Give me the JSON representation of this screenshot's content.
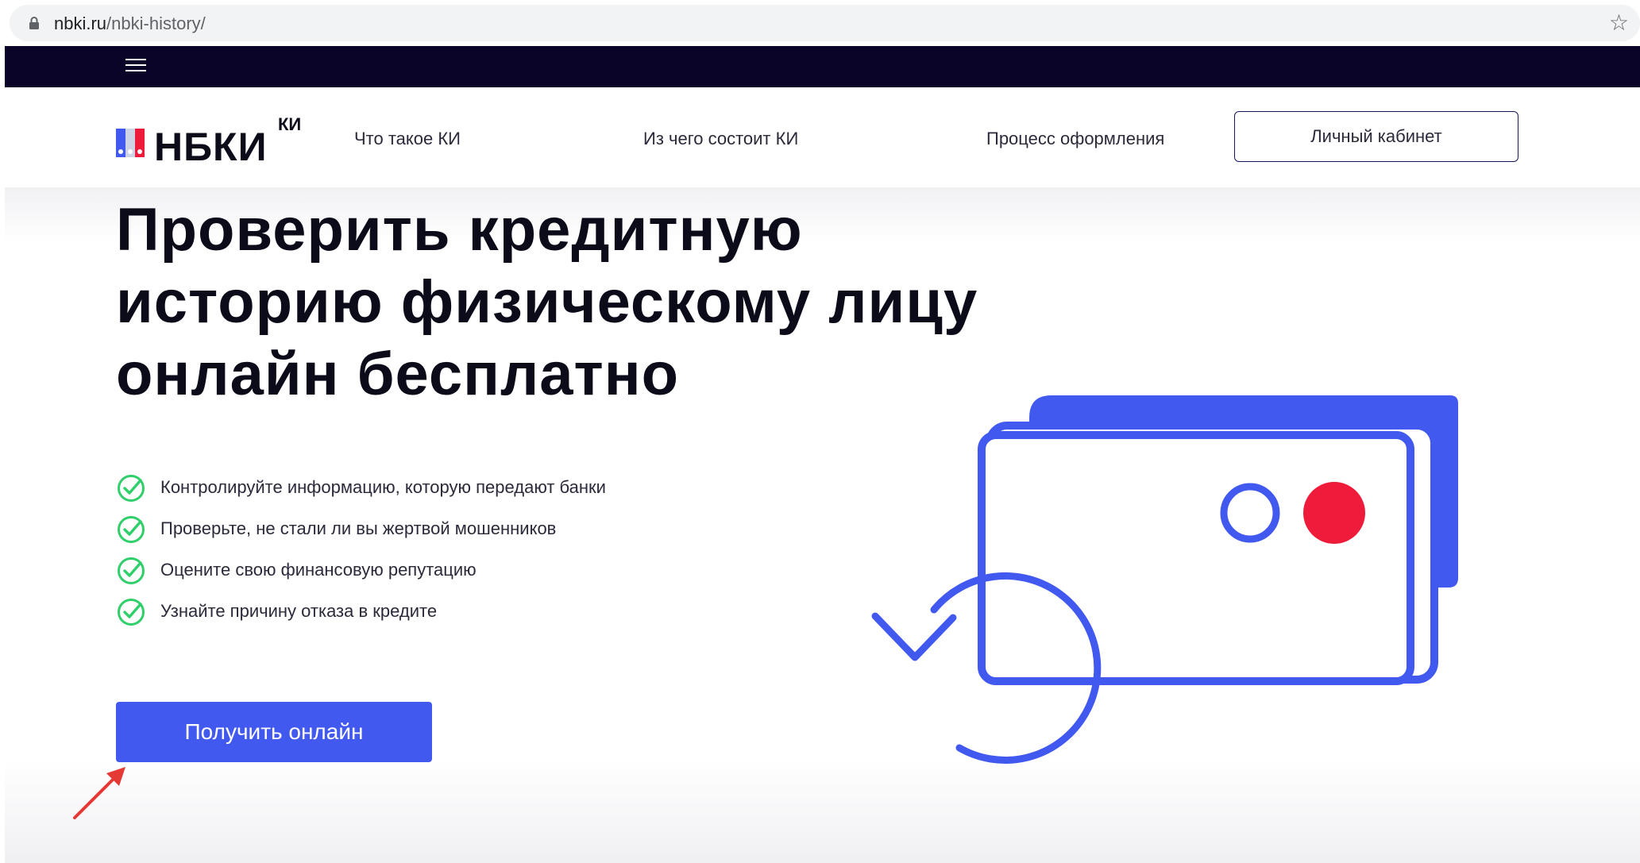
{
  "browser": {
    "url_host": "nbki.ru",
    "url_path": "/nbki-history/"
  },
  "header": {
    "logo_text": "НБКИ",
    "logo_sup": "КИ",
    "nav": [
      {
        "label": "Что такое КИ"
      },
      {
        "label": "Из чего состоит КИ"
      },
      {
        "label": "Процесс оформления"
      }
    ],
    "cabinet_label": "Личный кабинет"
  },
  "hero": {
    "title_lines": [
      "Проверить кредитную",
      "историю физическому лицу",
      "онлайн бесплатно"
    ],
    "benefits": [
      "Контролируйте информацию, которую передают банки",
      "Проверьте, не стали ли вы жертвой мошенников",
      "Оцените свою финансовую репутацию",
      "Узнайте причину отказа в кредите"
    ],
    "cta_label": "Получить онлайн"
  },
  "colors": {
    "accent_blue": "#4259f0",
    "dark_strip": "#0a0528",
    "check_green": "#2fcf6a",
    "logo_red": "#ee1c3a",
    "annotation_arrow": "#e53935"
  },
  "icons": [
    "lock-icon",
    "star-icon",
    "menu-icon",
    "check-icon",
    "annotation-arrow-icon"
  ]
}
